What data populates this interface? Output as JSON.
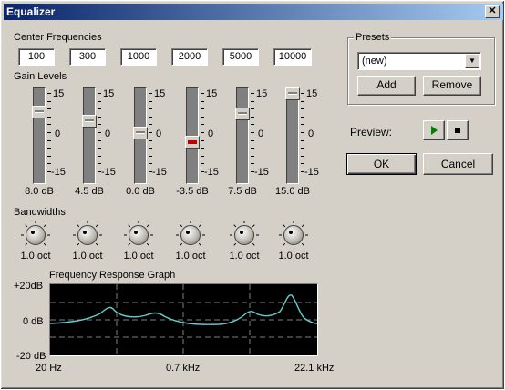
{
  "window": {
    "title": "Equalizer",
    "close_glyph": "✕"
  },
  "center_frequencies": {
    "label": "Center Frequencies",
    "values": [
      "100",
      "300",
      "1000",
      "2000",
      "5000",
      "10000"
    ]
  },
  "gain_levels": {
    "label": "Gain Levels",
    "scale_top": "15",
    "scale_mid": "0",
    "scale_bottom": "-15",
    "bands": [
      {
        "value_label": "8.0 dB",
        "gain_db": 8.0
      },
      {
        "value_label": "4.5 dB",
        "gain_db": 4.5
      },
      {
        "value_label": "0.0 dB",
        "gain_db": 0.0
      },
      {
        "value_label": "-3.5 dB",
        "gain_db": -3.5
      },
      {
        "value_label": "7.5 dB",
        "gain_db": 7.5
      },
      {
        "value_label": "15.0 dB",
        "gain_db": 15.0
      }
    ],
    "active_band": 3
  },
  "bandwidths": {
    "label": "Bandwidths",
    "values": [
      "1.0 oct",
      "1.0 oct",
      "1.0 oct",
      "1.0 oct",
      "1.0 oct",
      "1.0 oct"
    ]
  },
  "presets": {
    "label": "Presets",
    "selected": "(new)",
    "add_label": "Add",
    "remove_label": "Remove"
  },
  "preview": {
    "label": "Preview:",
    "play_icon": "play-icon",
    "stop_icon": "stop-icon"
  },
  "buttons": {
    "ok_label": "OK",
    "cancel_label": "Cancel"
  },
  "graph": {
    "title": "Frequency Response Graph",
    "y_top": "+20dB",
    "y_mid": "0 dB",
    "y_bottom": "-20 dB",
    "x_left": "20 Hz",
    "x_mid": "0.7 kHz",
    "x_right": "22.1 kHz",
    "line_color": "#66cccc"
  }
}
